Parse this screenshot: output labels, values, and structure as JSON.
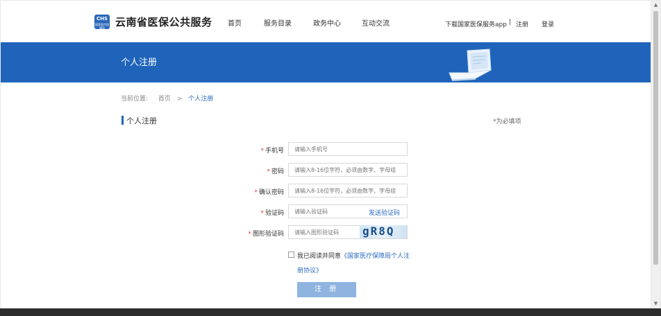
{
  "header": {
    "logo_text": "CHS",
    "logo_sub": "国家医疗保障局",
    "site_title": "云南省医保公共服务",
    "nav": [
      {
        "label": "首页"
      },
      {
        "label": "服务目录"
      },
      {
        "label": "政务中心"
      },
      {
        "label": "互动交流"
      }
    ],
    "download_app": "下载国家医保服务app",
    "separator": "|",
    "register": "注册",
    "login": "登录"
  },
  "banner": {
    "title": "个人注册"
  },
  "breadcrumb": {
    "prefix": "当前位置:",
    "home": "首页",
    "arrow": ">",
    "current": "个人注册"
  },
  "section": {
    "title": "个人注册",
    "required_note": "*为必填项"
  },
  "form": {
    "required_mark": "*",
    "phone": {
      "label": "手机号",
      "placeholder": "请输入手机号"
    },
    "password": {
      "label": "密码",
      "placeholder": "请输入8-16位字符，必须由数字、字母组"
    },
    "confirm_password": {
      "label": "确认密码",
      "placeholder": "请输入8-16位字符，必须由数字、字母组"
    },
    "sms_code": {
      "label": "验证码",
      "placeholder": "请输入验证码",
      "button": "发送验证码"
    },
    "image_code": {
      "label": "图形验证码",
      "placeholder": "请输入图形验证码",
      "captcha": "gR8Q"
    },
    "agree_prefix": "我已阅读并同意",
    "agree_link": "《国家医疗保障局个人注册协议》",
    "submit": "注 册"
  },
  "colors": {
    "brand_blue": "#1f64ba",
    "link_blue": "#2a6cc0",
    "required_red": "#e4393c",
    "submit_button": "#8eb4df"
  }
}
